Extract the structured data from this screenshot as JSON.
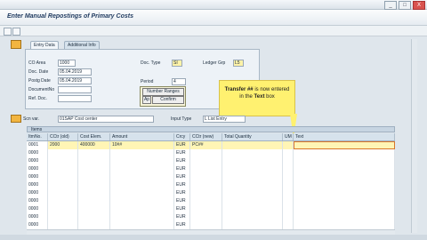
{
  "window": {
    "buttons": [
      "_",
      "□",
      "X"
    ]
  },
  "title": "Enter Manual Repostings of Primary Costs",
  "tabs": [
    "Entry Data",
    "Additional Info"
  ],
  "form": {
    "co_area_label": "CO Area",
    "co_area_value": "1000",
    "doc_date_label": "Doc. Date",
    "doc_date_value": "05.04.2019",
    "posting_date_label": "Postg Date",
    "posting_date_value": "05.04.2019",
    "document_no_label": "DocumentNo",
    "document_no_value": "",
    "ref_doc_label": "Ref. Doc.",
    "ref_doc_value": "",
    "doc_type_label": "Doc. Type",
    "doc_type_value": "SI",
    "ledger_grp_label": "Ledger Grp",
    "ledger_grp_value": "L5",
    "period_label": "Period",
    "period_value": "4"
  },
  "popup": {
    "item1": "Number Ranges",
    "item2": "Confirm",
    "short": "Ap"
  },
  "callout": {
    "bold": "Transfer ##",
    "text1": " is now entered in the ",
    "bold2": "Text",
    "text2": " box"
  },
  "scenario": {
    "label": "Scn var.",
    "value": "01SAP Cost center",
    "input_type_label": "Input Type",
    "input_type_value": "L List Entry"
  },
  "table": {
    "title": "Items",
    "columns": [
      "ItmNo.",
      "CCtr (old)",
      "Cost Elem.",
      "Amount",
      "Crcy",
      "CCtr (new)",
      "Total Quantity",
      "UM",
      "Text"
    ],
    "rows": [
      {
        "item": "0001",
        "cctr_old": "2000",
        "cost_elem": "400000",
        "amount": "10##",
        "crcy": "EUR",
        "cctr_new": "PC##"
      },
      {
        "item": "0000",
        "cctr_old": "",
        "cost_elem": "",
        "amount": "",
        "crcy": "EUR",
        "cctr_new": ""
      },
      {
        "item": "0000",
        "cctr_old": "",
        "cost_elem": "",
        "amount": "",
        "crcy": "EUR",
        "cctr_new": ""
      },
      {
        "item": "0000",
        "cctr_old": "",
        "cost_elem": "",
        "amount": "",
        "crcy": "EUR",
        "cctr_new": ""
      },
      {
        "item": "0000",
        "cctr_old": "",
        "cost_elem": "",
        "amount": "",
        "crcy": "EUR",
        "cctr_new": ""
      },
      {
        "item": "0000",
        "cctr_old": "",
        "cost_elem": "",
        "amount": "",
        "crcy": "EUR",
        "cctr_new": ""
      },
      {
        "item": "0000",
        "cctr_old": "",
        "cost_elem": "",
        "amount": "",
        "crcy": "EUR",
        "cctr_new": ""
      },
      {
        "item": "0000",
        "cctr_old": "",
        "cost_elem": "",
        "amount": "",
        "crcy": "EUR",
        "cctr_new": ""
      },
      {
        "item": "0000",
        "cctr_old": "",
        "cost_elem": "",
        "amount": "",
        "crcy": "EUR",
        "cctr_new": ""
      },
      {
        "item": "0000",
        "cctr_old": "",
        "cost_elem": "",
        "amount": "",
        "crcy": "EUR",
        "cctr_new": ""
      },
      {
        "item": "0000",
        "cctr_old": "",
        "cost_elem": "",
        "amount": "",
        "crcy": "EUR",
        "cctr_new": ""
      }
    ]
  }
}
